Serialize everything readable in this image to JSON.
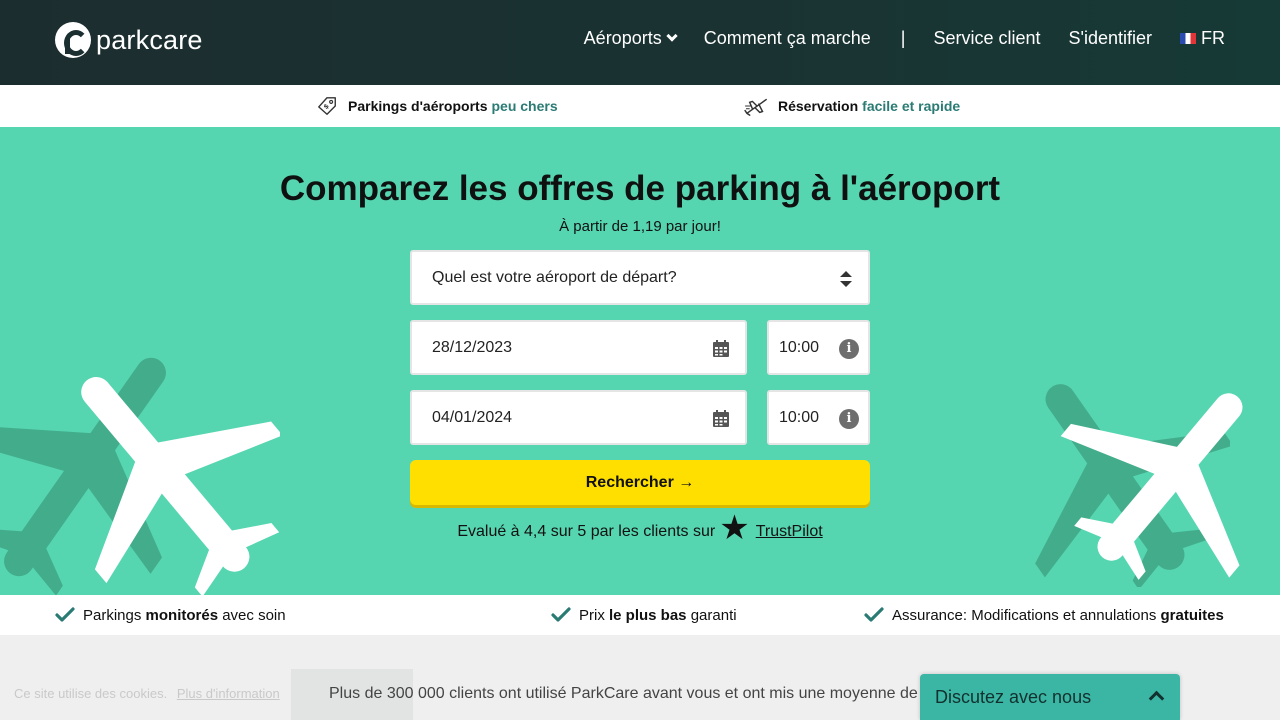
{
  "header": {
    "logo_text": "parkcare",
    "nav": {
      "airports": "Aéroports",
      "how_it_works": "Comment ça marche",
      "separator": "|",
      "customer_service": "Service client",
      "login": "S'identifier",
      "language": "FR"
    }
  },
  "strip": {
    "item1_main": "Parkings d'aéroports",
    "item1_highlight": "peu chers",
    "item2_main": "Réservation",
    "item2_highlight": "facile et rapide"
  },
  "hero": {
    "title": "Comparez les offres de parking à l'aéroport",
    "subtitle": "À partir de 1,19 par jour!",
    "airport_placeholder": "Quel est votre aéroport de départ?",
    "start_date": "28/12/2023",
    "start_time": "10:00",
    "end_date": "04/01/2024",
    "end_time": "10:00",
    "search_label": "Rechercher →",
    "rating_text": "Evalué à 4,4 sur 5 par les clients sur",
    "rating_link": "TrustPilot",
    "star_glyph": "★",
    "info_glyph": "i"
  },
  "features": {
    "f1_pre": "Parkings ",
    "f1_bold": "monitorés",
    "f1_post": " avec soin",
    "f2_pre": "Prix ",
    "f2_bold": "le plus bas",
    "f2_post": " garanti",
    "f3_pre": "Assurance: Modifications et annulations ",
    "f3_bold": "gratuites"
  },
  "bottom": {
    "cookie_text": "Ce site utilise des cookies.",
    "cookie_more": "Plus d'information",
    "stats_text": "Plus de 300 000 clients ont utilisé ParkCare avant vous et ont mis une moyenne de",
    "chat_label": "Discutez avec nous"
  },
  "colors": {
    "header_bg": "#1b3030",
    "hero_bg": "#56d6b0",
    "accent_teal": "#2a7b74",
    "button_yellow": "#ffdf00",
    "chat_bg": "#3bb6a5"
  },
  "icons": [
    "logo-icon",
    "chevron-down-icon",
    "flag-fr-icon",
    "price-tag-icon",
    "plane-icon",
    "sort-icon",
    "calendar-icon",
    "info-icon",
    "star-icon",
    "check-icon",
    "chevron-up-icon"
  ]
}
